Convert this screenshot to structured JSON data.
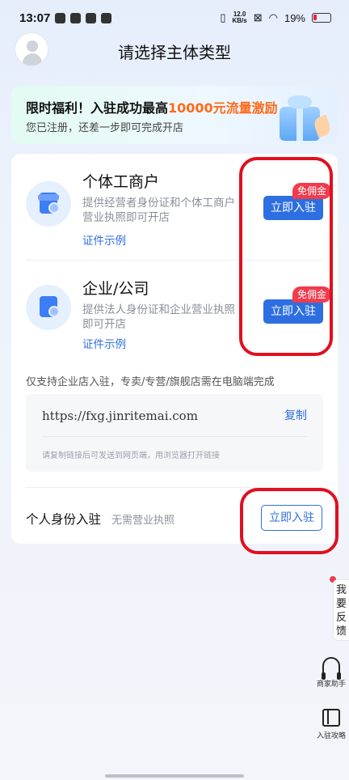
{
  "status_bar": {
    "time": "13:07",
    "speed_value": "12.0",
    "speed_unit": "KB/s",
    "battery": "19%"
  },
  "header": {
    "title": "请选择主体类型"
  },
  "promo": {
    "title_prefix": "限时福利！入驻成功最高",
    "title_highlight": "10000元流量激励",
    "subtitle": "您已注册，还差一步即可完成开店"
  },
  "options": [
    {
      "title": "个体工商户",
      "desc": "提供经营者身份证和个体工商户营业执照即可开店",
      "link": "证件示例",
      "badge": "免佣金",
      "button": "立即入驻"
    },
    {
      "title": "企业/公司",
      "desc": "提供法人身份证和企业营业执照即可开店",
      "link": "证件示例",
      "badge": "免佣金",
      "button": "立即入驻"
    }
  ],
  "notice": "仅支持企业店入驻，专卖/专营/旗舰店需在电脑端完成",
  "link_box": {
    "url": "https://fxg.jinritemai.com",
    "copy_label": "复制",
    "hint": "请复制链接后可发送到网页端，用浏览器打开链接"
  },
  "personal": {
    "title": "个人身份入驻",
    "subtitle": "无需营业执照",
    "button": "立即入驻"
  },
  "side": {
    "feedback": "我要反馈",
    "helper_label": "商家助手",
    "guide_label": "入驻攻略"
  },
  "colors": {
    "accent": "#2d6fe0",
    "badge": "#f03c4c",
    "highlight": "#ff6a1a",
    "annotation": "#e0101f"
  }
}
